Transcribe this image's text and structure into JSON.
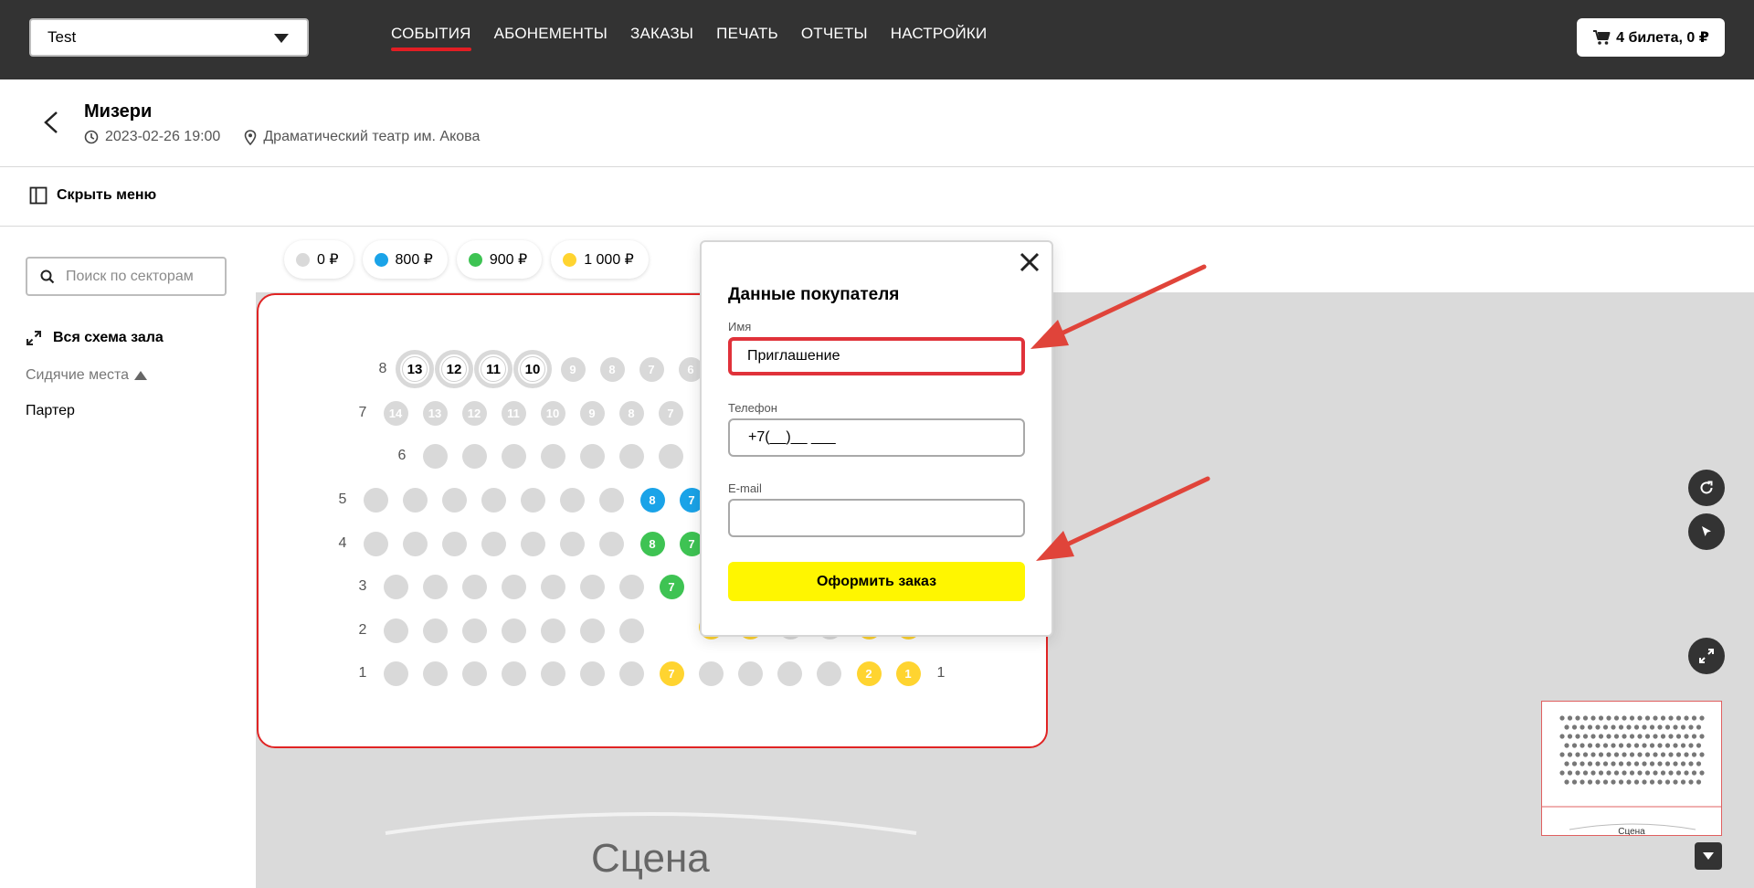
{
  "header": {
    "org_select": "Test",
    "nav": [
      "СОБЫТИЯ",
      "АБОНЕМЕНТЫ",
      "ЗАКАЗЫ",
      "ПЕЧАТЬ",
      "ОТЧЕТЫ",
      "НАСТРОЙКИ"
    ],
    "active_nav": "СОБЫТИЯ",
    "cart_label": "4 билета, 0 ₽"
  },
  "event": {
    "title": "Мизери",
    "datetime": "2023-02-26 19:00",
    "venue": "Драматический театр им. Акова"
  },
  "toolbar": {
    "hide_menu": "Скрыть меню"
  },
  "sidebar": {
    "search_placeholder": "Поиск по секторам",
    "full_scheme": "Вся схема зала",
    "seat_type": "Сидячие места",
    "sector": "Партер"
  },
  "prices": [
    {
      "label": "0 ₽",
      "color": "#d9d9d9"
    },
    {
      "label": "800 ₽",
      "color": "#1aa3e8"
    },
    {
      "label": "900 ₽",
      "color": "#3ec353"
    },
    {
      "label": "1 000 ₽",
      "color": "#ffd430"
    }
  ],
  "hall": {
    "selected_seats": [
      "13",
      "12",
      "11",
      "10"
    ],
    "seat_numbers": {
      "r8": [
        "9",
        "8",
        "7",
        "6"
      ],
      "r7": [
        "14",
        "13",
        "12",
        "11",
        "10",
        "9",
        "8",
        "7"
      ],
      "r5": [
        "8",
        "7"
      ],
      "r4": [
        "8",
        "7"
      ],
      "r3": [
        "7"
      ],
      "r1": [
        "7",
        "2",
        "1"
      ]
    },
    "row_labels": [
      "8",
      "7",
      "6",
      "5",
      "4",
      "3",
      "2",
      "1"
    ],
    "row1_right_label": "1",
    "stage": "Сцена",
    "minimap_stage": "Сцена"
  },
  "modal": {
    "title": "Данные покупателя",
    "name_label": "Имя",
    "name_value": "Приглашение",
    "phone_label": "Телефон",
    "phone_value": "+7(__)__ ___",
    "email_label": "E-mail",
    "email_value": "",
    "submit": "Оформить заказ"
  },
  "icons": [
    "cart-icon",
    "back-arrow-icon",
    "clock-icon",
    "location-pin-icon",
    "sidebar-toggle-icon",
    "search-icon",
    "expand-icon",
    "close-icon",
    "refresh-icon",
    "cursor-icon",
    "fullscreen-icon",
    "chevron-down-icon"
  ]
}
